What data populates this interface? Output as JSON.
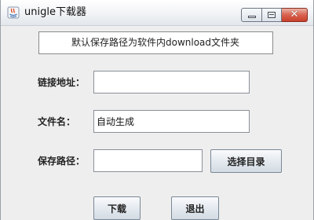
{
  "window": {
    "title": "unigle下载器"
  },
  "info": {
    "text": "默认保存路径为软件内download文件夹"
  },
  "form": {
    "url_label": "链接地址：",
    "url_value": "",
    "filename_label": "文件名：",
    "filename_value": "自动生成",
    "savepath_label": "保存路径：",
    "savepath_value": "",
    "choose_dir_label": "选择目录"
  },
  "actions": {
    "download_label": "下载",
    "exit_label": "退出"
  }
}
